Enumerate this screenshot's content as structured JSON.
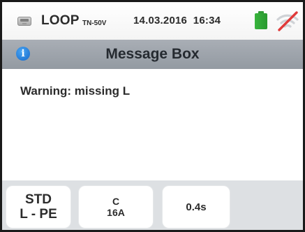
{
  "status_bar": {
    "function_name": "LOOP",
    "function_subtitle": "TN-50V",
    "datetime": "14.03.2016  16:34",
    "icons": {
      "instrument": "meter-icon",
      "battery": "battery-icon",
      "wireless": "wifi-off-icon"
    },
    "battery_color": "#2fa336",
    "wireless_strike_color": "#e03a3a"
  },
  "title_bar": {
    "icon": "info-icon",
    "icon_glyph": "i",
    "title": "Message Box"
  },
  "message": {
    "text": "Warning: missing L"
  },
  "parameters": {
    "standard": {
      "line1": "STD",
      "line2": "L - PE"
    },
    "fuse": {
      "line1": "C",
      "line2": "16A"
    },
    "time": {
      "line1": "0.4s"
    }
  },
  "colors": {
    "title_bar": "#9ea4ab",
    "parameter_bar": "#dde0e3",
    "info_icon": "#1f7fe0"
  }
}
